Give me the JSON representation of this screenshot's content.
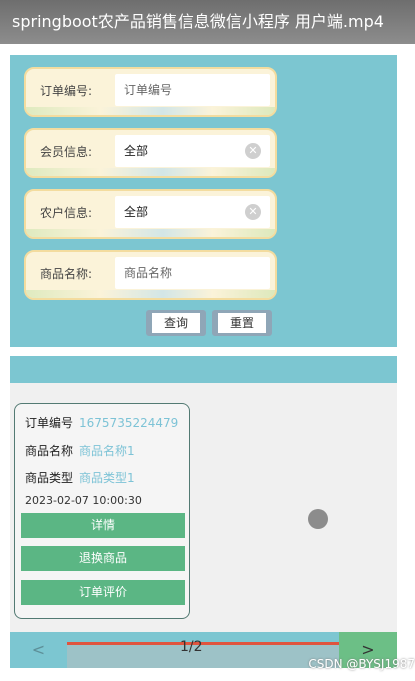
{
  "window": {
    "title": "springboot农产品销售信息微信小程序 用户端.mp4",
    "overlay": ""
  },
  "search": {
    "fields": [
      {
        "label": "订单编号:",
        "placeholder": "订单编号",
        "type": "input"
      },
      {
        "label": "会员信息:",
        "value": "全部",
        "type": "select"
      },
      {
        "label": "农户信息:",
        "value": "全部",
        "type": "select"
      },
      {
        "label": "商品名称:",
        "placeholder": "商品名称",
        "type": "input"
      }
    ],
    "query_label": "查询",
    "reset_label": "重置"
  },
  "order": {
    "number_key": "订单编号",
    "number_value": "1675735224479",
    "product_key": "商品名称",
    "product_value": "商品名称1",
    "type_key": "商品类型",
    "type_value": "商品类型1",
    "date": "2023-02-07 10:00:30",
    "detail_label": "详情",
    "return_label": "退换商品",
    "review_label": "订单评价"
  },
  "pager": {
    "prev": "<",
    "page": "1/2",
    "next": ">"
  },
  "watermark": "CSDN @BYSJ1987",
  "colors": {
    "panel": "#7cc6d1",
    "button_green": "#5bb684",
    "value_text": "#7dc3d6"
  },
  "icons": {
    "clear": "clear-circle-icon"
  }
}
